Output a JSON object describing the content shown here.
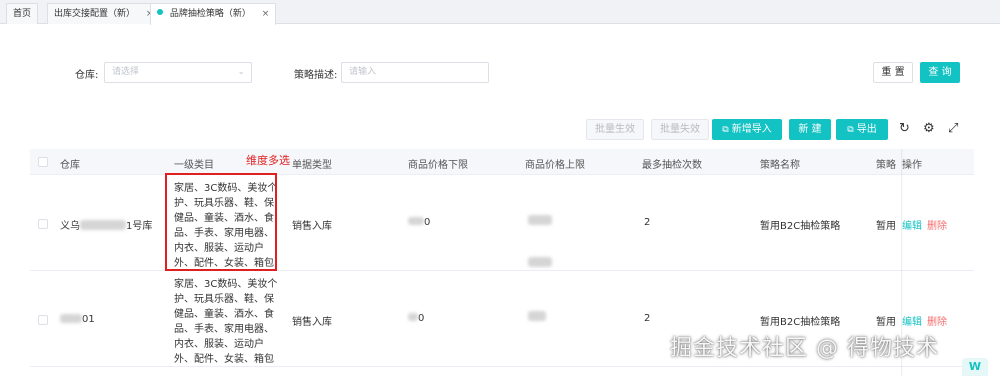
{
  "tabs": [
    {
      "label": "首页",
      "closable": false,
      "active": false
    },
    {
      "label": "出库交接配置（新）",
      "closable": true,
      "active": false
    },
    {
      "label": "品牌抽检策略（新）",
      "closable": true,
      "active": true
    }
  ],
  "filters": {
    "warehouse_label": "仓库:",
    "warehouse_placeholder": "请选择",
    "desc_label": "策略描述:",
    "desc_placeholder": "请输入",
    "reset_label": "重 置",
    "query_label": "查 询"
  },
  "toolbar": {
    "batch_enable": "批量生效",
    "batch_disable": "批量失效",
    "new_import": "新增导入",
    "create": "新 建",
    "export": "导出"
  },
  "table": {
    "columns": [
      "仓库",
      "一级类目",
      "单据类型",
      "商品价格下限",
      "商品价格上限",
      "最多抽检次数",
      "策略名称",
      "策略",
      "操作"
    ],
    "rows": [
      {
        "warehouse": "义乌",
        "warehouse_suffix": "1号库",
        "category": "家居、3C数码、美妆个护、玩具乐器、鞋、保健品、童装、酒水、食品、手表、家用电器、内衣、服装、运动户外、配件、女装、箱包",
        "doc_type": "销售入库",
        "price_low_suffix": "0",
        "max_checks": "2",
        "policy_name": "暂用B2C抽检策略",
        "policy_short": "暂用",
        "edit": "编辑",
        "delete": "删除"
      },
      {
        "warehouse_suffix": "01",
        "category": "家居、3C数码、美妆个护、玩具乐器、鞋、保健品、童装、酒水、食品、手表、家用电器、内衣、服装、运动户外、配件、女装、箱包",
        "doc_type": "销售入库",
        "price_low_suffix": "0",
        "max_checks": "2",
        "policy_name": "暂用B2C抽检策略",
        "policy_short": "暂用",
        "edit": "编辑",
        "delete": "删除"
      }
    ]
  },
  "annotation": "维度多选",
  "watermark": "掘金技术社区 @ 得物技术",
  "colors": {
    "primary": "#13c2c2",
    "danger": "#f56c6c",
    "highlight": "#e02020"
  },
  "icons": [
    "chevron-down-icon",
    "external-link-icon",
    "refresh-icon",
    "gear-icon",
    "fullscreen-icon",
    "close-icon"
  ]
}
